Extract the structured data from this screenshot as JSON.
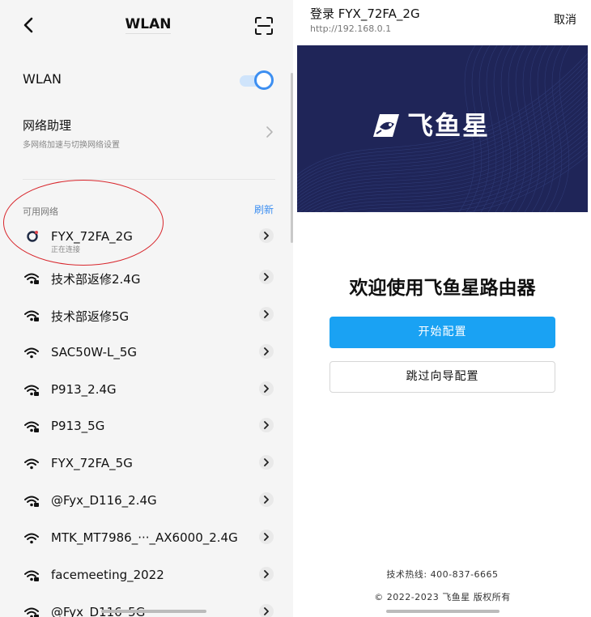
{
  "left": {
    "title": "WLAN",
    "wlan_label": "WLAN",
    "wlan_enabled": true,
    "assistant": {
      "title": "网络助理",
      "subtitle": "多网络加速与切换网络设置"
    },
    "available_label": "可用网络",
    "refresh_label": "刷新",
    "networks": [
      {
        "name": "FYX_72FA_2G",
        "status": "正在连接",
        "icon": "connecting-icon"
      },
      {
        "name": "技术部返修2.4G",
        "icon": "wifi-locked-icon"
      },
      {
        "name": "技术部返修5G",
        "icon": "wifi-locked-icon"
      },
      {
        "name": "SAC50W-L_5G",
        "icon": "wifi-icon"
      },
      {
        "name": "P913_2.4G",
        "icon": "wifi-locked-icon"
      },
      {
        "name": "P913_5G",
        "icon": "wifi-locked-icon"
      },
      {
        "name": "FYX_72FA_5G",
        "icon": "wifi-icon"
      },
      {
        "name": "@Fyx_D116_2.4G",
        "icon": "wifi-locked-icon"
      },
      {
        "name": "MTK_MT7986_···_AX6000_2.4G",
        "icon": "wifi-icon"
      },
      {
        "name": "facemeeting_2022",
        "icon": "wifi-locked-icon"
      },
      {
        "name": "@Fyx_D116_5G",
        "icon": "wifi-locked-icon"
      }
    ],
    "accent_color": "#3d8ff1",
    "annotation_color": "#d8262c"
  },
  "right": {
    "title": "登录 FYX_72FA_2G",
    "url": "http://192.168.0.1",
    "cancel_label": "取消",
    "brand": "飞鱼星",
    "welcome": "欢迎使用飞鱼星路由器",
    "start_label": "开始配置",
    "skip_label": "跳过向导配置",
    "hotline": "技术热线: 400-837-6665",
    "copyright": "© 2022-2023 飞鱼星 版权所有",
    "primary_color": "#1aa2f3",
    "banner_color": "#1f2558"
  }
}
